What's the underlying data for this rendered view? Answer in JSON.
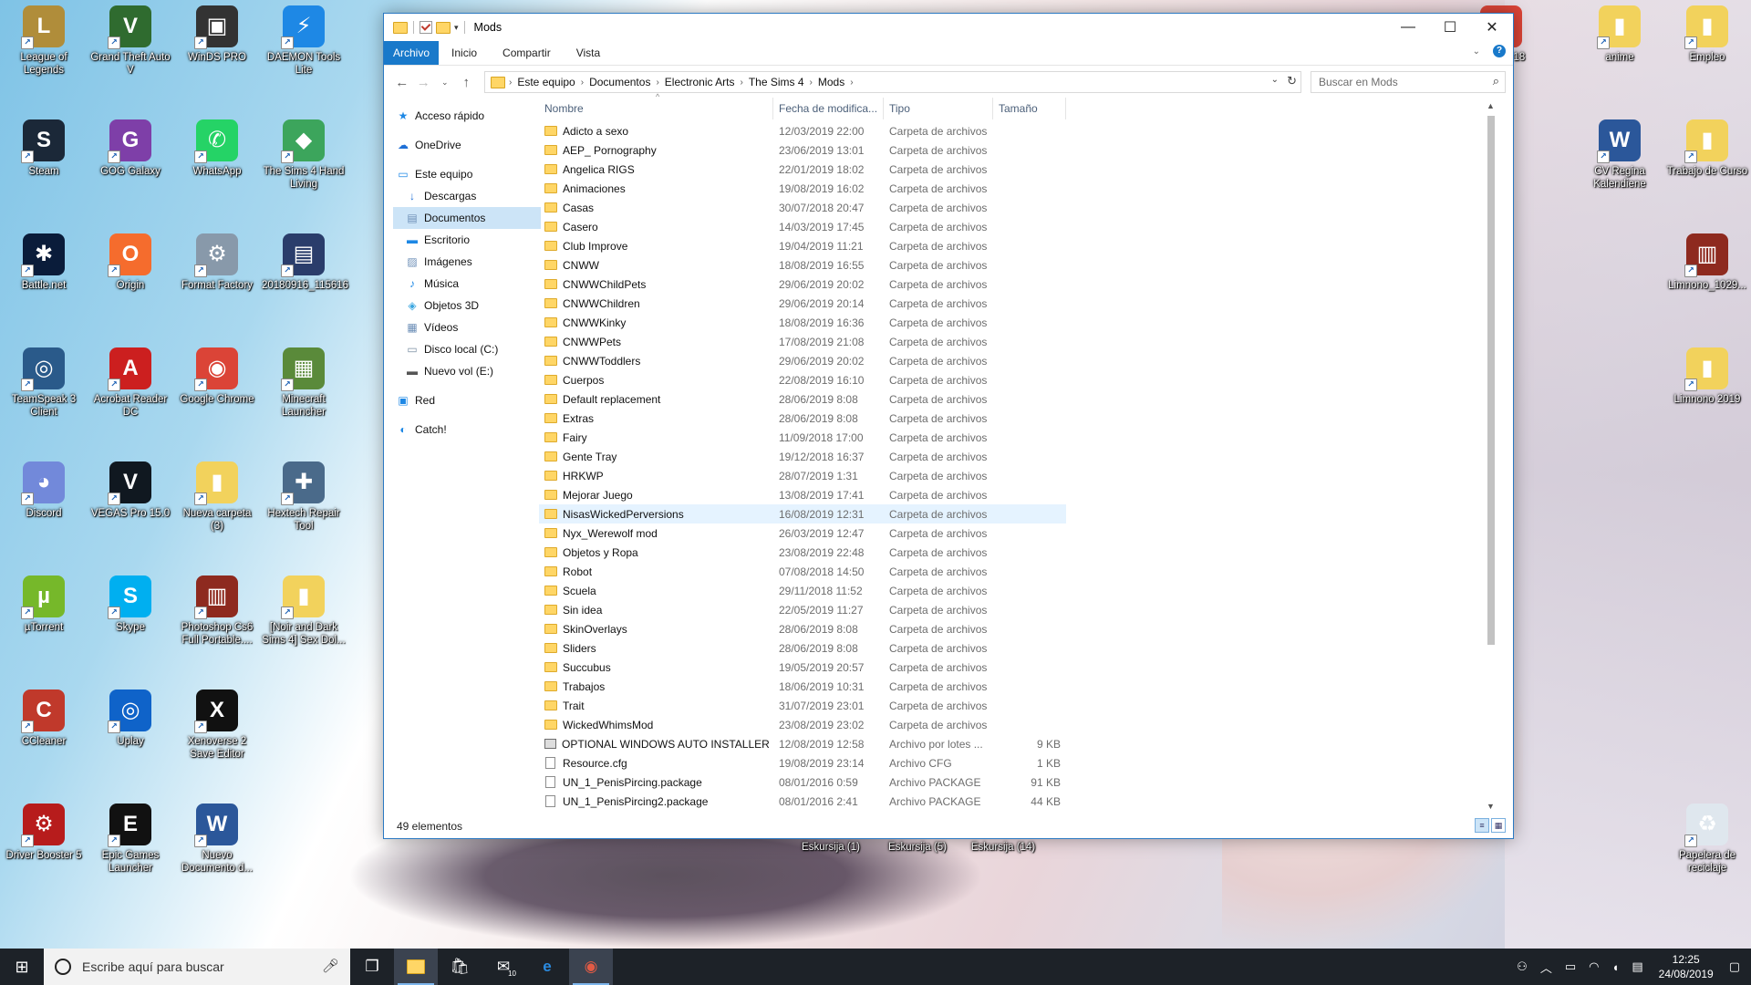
{
  "desktop": {
    "icons": [
      {
        "label": "League of Legends",
        "glyph": "L",
        "color": "#b08d3a"
      },
      {
        "label": "Grand Theft Auto V",
        "glyph": "V",
        "color": "#2f6b2f"
      },
      {
        "label": "WinDS PRO",
        "glyph": "▣",
        "color": "#333"
      },
      {
        "label": "DAEMON Tools Lite",
        "glyph": "⚡",
        "color": "#1e88e5"
      },
      {
        "label": "Steam",
        "glyph": "S",
        "color": "#1b2838"
      },
      {
        "label": "GOG Galaxy",
        "glyph": "G",
        "color": "#7e3fa8"
      },
      {
        "label": "WhatsApp",
        "glyph": "✆",
        "color": "#25d366"
      },
      {
        "label": "The Sims 4 Hand Living",
        "glyph": "◆",
        "color": "#3ca55c"
      },
      {
        "label": "Battle.net",
        "glyph": "✱",
        "color": "#0a1c3a"
      },
      {
        "label": "Origin",
        "glyph": "O",
        "color": "#f56c2d"
      },
      {
        "label": "Format Factory",
        "glyph": "⚙",
        "color": "#8899aa"
      },
      {
        "label": "20180916_115616",
        "glyph": "▤",
        "color": "#2a3d6b"
      },
      {
        "label": "TeamSpeak 3 Client",
        "glyph": "◎",
        "color": "#2a5a8a"
      },
      {
        "label": "Acrobat Reader DC",
        "glyph": "A",
        "color": "#cc1f1f"
      },
      {
        "label": "Google Chrome",
        "glyph": "◉",
        "color": "#db4437"
      },
      {
        "label": "Minecraft Launcher",
        "glyph": "▦",
        "color": "#5a8a3a"
      },
      {
        "label": "Discord",
        "glyph": "◕",
        "color": "#7289da"
      },
      {
        "label": "VEGAS Pro 15.0",
        "glyph": "V",
        "color": "#101820"
      },
      {
        "label": "Nueva carpeta (3)",
        "glyph": "▮",
        "color": "#f2d25c"
      },
      {
        "label": "Hextech Repair Tool",
        "glyph": "✚",
        "color": "#4a6a8a"
      },
      {
        "label": "µTorrent",
        "glyph": "µ",
        "color": "#76b82a"
      },
      {
        "label": "Skype",
        "glyph": "S",
        "color": "#00aff0"
      },
      {
        "label": "Photoshop Cs6 Full Portable....",
        "glyph": "▥",
        "color": "#8e2a1f"
      },
      {
        "label": "[Noir and Dark Sims 4] Sex Dol...",
        "glyph": "▮",
        "color": "#f2d25c"
      },
      {
        "label": "CCleaner",
        "glyph": "C",
        "color": "#c0392b"
      },
      {
        "label": "Uplay",
        "glyph": "◎",
        "color": "#0f63c9"
      },
      {
        "label": "Xenoverse 2 Save Editor",
        "glyph": "X",
        "color": "#111"
      },
      {
        "label": "Driver Booster 5",
        "glyph": "⚙",
        "color": "#b71c1c"
      },
      {
        "label": "Epic Games Launcher",
        "glyph": "E",
        "color": "#111"
      },
      {
        "label": "Nuevo Documento d...",
        "glyph": "W",
        "color": "#2b579a"
      },
      {
        "label": "Eskursija (1)",
        "glyph": "",
        "color": "transparent"
      },
      {
        "label": "Eskursija (5)",
        "glyph": "",
        "color": "transparent"
      },
      {
        "label": "Eskursija (14)",
        "glyph": "",
        "color": "transparent"
      },
      {
        "label": "anime",
        "glyph": "▮",
        "color": "#f2d25c"
      },
      {
        "label": "Empleo",
        "glyph": "▮",
        "color": "#f2d25c"
      },
      {
        "label": "CV Regina Kalendiene",
        "glyph": "W",
        "color": "#2b579a"
      },
      {
        "label": "Trabajo de Curso",
        "glyph": "▮",
        "color": "#f2d25c"
      },
      {
        "label": "Limnono_1029...",
        "glyph": "▥",
        "color": "#8e2a1f"
      },
      {
        "label": "Limnono 2019",
        "glyph": "▮",
        "color": "#f2d25c"
      },
      {
        "label": "Papelera de reciclaje",
        "glyph": "♻",
        "color": "#dfe7ee"
      },
      {
        "label": "1-07-2018",
        "glyph": "◉",
        "color": "#db4437"
      }
    ]
  },
  "window": {
    "title": "Mods",
    "controls": {
      "minimize": "—",
      "maximize": "☐",
      "close": "✕"
    },
    "ribbon_tabs": [
      "Archivo",
      "Inicio",
      "Compartir",
      "Vista"
    ],
    "breadcrumb": [
      "Este equipo",
      "Documentos",
      "Electronic Arts",
      "The Sims 4",
      "Mods"
    ],
    "search_placeholder": "Buscar en Mods",
    "nav": [
      {
        "label": "Acceso rápido",
        "icon": "★",
        "color": "#1e88e5",
        "sub": false
      },
      {
        "label": "OneDrive",
        "icon": "☁",
        "color": "#1e6fd6",
        "sub": false
      },
      {
        "label": "Este equipo",
        "icon": "▭",
        "color": "#1e88e5",
        "sub": false
      },
      {
        "label": "Descargas",
        "icon": "↓",
        "color": "#1e6fd6",
        "sub": true
      },
      {
        "label": "Documentos",
        "icon": "▤",
        "color": "#6d8fb7",
        "sub": true
      },
      {
        "label": "Escritorio",
        "icon": "▬",
        "color": "#1e88e5",
        "sub": true
      },
      {
        "label": "Imágenes",
        "icon": "▨",
        "color": "#6d8fb7",
        "sub": true
      },
      {
        "label": "Música",
        "icon": "♪",
        "color": "#1e88e5",
        "sub": true
      },
      {
        "label": "Objetos 3D",
        "icon": "◈",
        "color": "#3aa6e0",
        "sub": true
      },
      {
        "label": "Vídeos",
        "icon": "▦",
        "color": "#6d8fb7",
        "sub": true
      },
      {
        "label": "Disco local (C:)",
        "icon": "▭",
        "color": "#7a8ea3",
        "sub": true
      },
      {
        "label": "Nuevo vol (E:)",
        "icon": "▬",
        "color": "#555",
        "sub": true
      },
      {
        "label": "Red",
        "icon": "▣",
        "color": "#1e88e5",
        "sub": false
      },
      {
        "label": "Catch!",
        "icon": "◐",
        "color": "#1e88e5",
        "sub": false
      }
    ],
    "columns": [
      "Nombre",
      "Fecha de modifica...",
      "Tipo",
      "Tamaño"
    ],
    "files": [
      {
        "name": "Adicto a sexo",
        "date": "12/03/2019 22:00",
        "type": "Carpeta de archivos",
        "size": "",
        "kind": "folder"
      },
      {
        "name": "AEP_ Pornography",
        "date": "23/06/2019 13:01",
        "type": "Carpeta de archivos",
        "size": "",
        "kind": "folder"
      },
      {
        "name": "Angelica RIGS",
        "date": "22/01/2019 18:02",
        "type": "Carpeta de archivos",
        "size": "",
        "kind": "folder"
      },
      {
        "name": "Animaciones",
        "date": "19/08/2019 16:02",
        "type": "Carpeta de archivos",
        "size": "",
        "kind": "folder"
      },
      {
        "name": "Casas",
        "date": "30/07/2018 20:47",
        "type": "Carpeta de archivos",
        "size": "",
        "kind": "folder"
      },
      {
        "name": "Casero",
        "date": "14/03/2019 17:45",
        "type": "Carpeta de archivos",
        "size": "",
        "kind": "folder"
      },
      {
        "name": "Club Improve",
        "date": "19/04/2019 11:21",
        "type": "Carpeta de archivos",
        "size": "",
        "kind": "folder"
      },
      {
        "name": "CNWW",
        "date": "18/08/2019 16:55",
        "type": "Carpeta de archivos",
        "size": "",
        "kind": "folder"
      },
      {
        "name": "CNWWChildPets",
        "date": "29/06/2019 20:02",
        "type": "Carpeta de archivos",
        "size": "",
        "kind": "folder"
      },
      {
        "name": "CNWWChildren",
        "date": "29/06/2019 20:14",
        "type": "Carpeta de archivos",
        "size": "",
        "kind": "folder"
      },
      {
        "name": "CNWWKinky",
        "date": "18/08/2019 16:36",
        "type": "Carpeta de archivos",
        "size": "",
        "kind": "folder"
      },
      {
        "name": "CNWWPets",
        "date": "17/08/2019 21:08",
        "type": "Carpeta de archivos",
        "size": "",
        "kind": "folder"
      },
      {
        "name": "CNWWToddlers",
        "date": "29/06/2019 20:02",
        "type": "Carpeta de archivos",
        "size": "",
        "kind": "folder"
      },
      {
        "name": "Cuerpos",
        "date": "22/08/2019 16:10",
        "type": "Carpeta de archivos",
        "size": "",
        "kind": "folder"
      },
      {
        "name": "Default replacement",
        "date": "28/06/2019 8:08",
        "type": "Carpeta de archivos",
        "size": "",
        "kind": "folder"
      },
      {
        "name": "Extras",
        "date": "28/06/2019 8:08",
        "type": "Carpeta de archivos",
        "size": "",
        "kind": "folder"
      },
      {
        "name": "Fairy",
        "date": "11/09/2018 17:00",
        "type": "Carpeta de archivos",
        "size": "",
        "kind": "folder"
      },
      {
        "name": "Gente Tray",
        "date": "19/12/2018 16:37",
        "type": "Carpeta de archivos",
        "size": "",
        "kind": "folder"
      },
      {
        "name": "HRKWP",
        "date": "28/07/2019 1:31",
        "type": "Carpeta de archivos",
        "size": "",
        "kind": "folder"
      },
      {
        "name": "Mejorar Juego",
        "date": "13/08/2019 17:41",
        "type": "Carpeta de archivos",
        "size": "",
        "kind": "folder"
      },
      {
        "name": "NisasWickedPerversions",
        "date": "16/08/2019 12:31",
        "type": "Carpeta de archivos",
        "size": "",
        "kind": "folder"
      },
      {
        "name": "Nyx_Werewolf mod",
        "date": "26/03/2019 12:47",
        "type": "Carpeta de archivos",
        "size": "",
        "kind": "folder"
      },
      {
        "name": "Objetos y Ropa",
        "date": "23/08/2019 22:48",
        "type": "Carpeta de archivos",
        "size": "",
        "kind": "folder"
      },
      {
        "name": "Robot",
        "date": "07/08/2018 14:50",
        "type": "Carpeta de archivos",
        "size": "",
        "kind": "folder"
      },
      {
        "name": "Scuela",
        "date": "29/11/2018 11:52",
        "type": "Carpeta de archivos",
        "size": "",
        "kind": "folder"
      },
      {
        "name": "Sin idea",
        "date": "22/05/2019 11:27",
        "type": "Carpeta de archivos",
        "size": "",
        "kind": "folder"
      },
      {
        "name": "SkinOverlays",
        "date": "28/06/2019 8:08",
        "type": "Carpeta de archivos",
        "size": "",
        "kind": "folder"
      },
      {
        "name": "Sliders",
        "date": "28/06/2019 8:08",
        "type": "Carpeta de archivos",
        "size": "",
        "kind": "folder"
      },
      {
        "name": "Succubus",
        "date": "19/05/2019 20:57",
        "type": "Carpeta de archivos",
        "size": "",
        "kind": "folder"
      },
      {
        "name": "Trabajos",
        "date": "18/06/2019 10:31",
        "type": "Carpeta de archivos",
        "size": "",
        "kind": "folder"
      },
      {
        "name": "Trait",
        "date": "31/07/2019 23:01",
        "type": "Carpeta de archivos",
        "size": "",
        "kind": "folder"
      },
      {
        "name": "WickedWhimsMod",
        "date": "23/08/2019 23:02",
        "type": "Carpeta de archivos",
        "size": "",
        "kind": "folder"
      },
      {
        "name": "OPTIONAL WINDOWS AUTO INSTALLER",
        "date": "12/08/2019 12:58",
        "type": "Archivo por lotes ...",
        "size": "9 KB",
        "kind": "bat"
      },
      {
        "name": "Resource.cfg",
        "date": "19/08/2019 23:14",
        "type": "Archivo CFG",
        "size": "1 KB",
        "kind": "file"
      },
      {
        "name": "UN_1_PenisPircing.package",
        "date": "08/01/2016 0:59",
        "type": "Archivo PACKAGE",
        "size": "91 KB",
        "kind": "file"
      },
      {
        "name": "UN_1_PenisPircing2.package",
        "date": "08/01/2016 2:41",
        "type": "Archivo PACKAGE",
        "size": "44 KB",
        "kind": "file"
      }
    ],
    "status": "49 elementos"
  },
  "taskbar": {
    "search_placeholder": "Escribe aquí para buscar",
    "time": "12:25",
    "date": "24/08/2019",
    "mail_badge": "10"
  }
}
